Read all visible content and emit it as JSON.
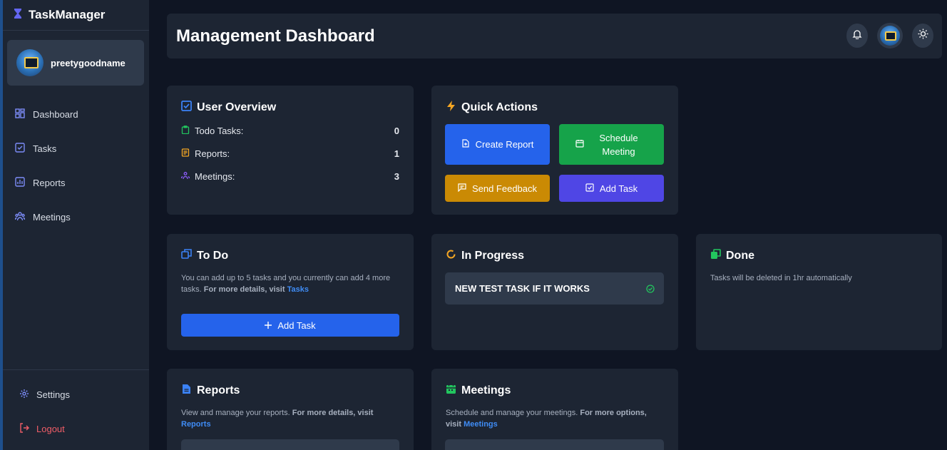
{
  "brand": {
    "title": "TaskManager"
  },
  "user": {
    "name": "preetygoodname"
  },
  "nav": [
    {
      "label": "Dashboard",
      "icon": "dashboard-icon"
    },
    {
      "label": "Tasks",
      "icon": "checkbox-icon"
    },
    {
      "label": "Reports",
      "icon": "chart-icon"
    },
    {
      "label": "Meetings",
      "icon": "people-icon"
    }
  ],
  "bottom_nav": {
    "settings": "Settings",
    "logout": "Logout"
  },
  "header": {
    "title": "Management Dashboard"
  },
  "overview": {
    "title": "User Overview",
    "rows": [
      {
        "label": "Todo Tasks:",
        "value": "0",
        "color": "#22c55e"
      },
      {
        "label": "Reports:",
        "value": "1",
        "color": "#f5a623"
      },
      {
        "label": "Meetings:",
        "value": "3",
        "color": "#8b5cf6"
      }
    ]
  },
  "quick_actions": {
    "title": "Quick Actions",
    "create_report": "Create Report",
    "schedule_meeting": "Schedule Meeting",
    "send_feedback": "Send Feedback",
    "add_task": "Add Task"
  },
  "todo": {
    "title": "To Do",
    "text_1": "You can add up to 5 tasks and you currently can add 4 more tasks.",
    "text_bold": "For more details, visit",
    "link": "Tasks",
    "button": "Add Task"
  },
  "in_progress": {
    "title": "In Progress",
    "task": "NEW TEST TASK IF IT WORKS"
  },
  "done": {
    "title": "Done",
    "text": "Tasks will be deleted in 1hr automatically"
  },
  "reports": {
    "title": "Reports",
    "text_1": "View and manage your reports.",
    "text_bold": "For more details, visit",
    "link": "Reports"
  },
  "meetings": {
    "title": "Meetings",
    "text_1": "Schedule and manage your meetings.",
    "text_bold": "For more options, visit",
    "link": "Meetings"
  },
  "colors": {
    "primary": "#2563eb",
    "success": "#16a34a",
    "warning": "#ca8a04",
    "indigo": "#4f46e5",
    "danger": "#ef5d67"
  }
}
